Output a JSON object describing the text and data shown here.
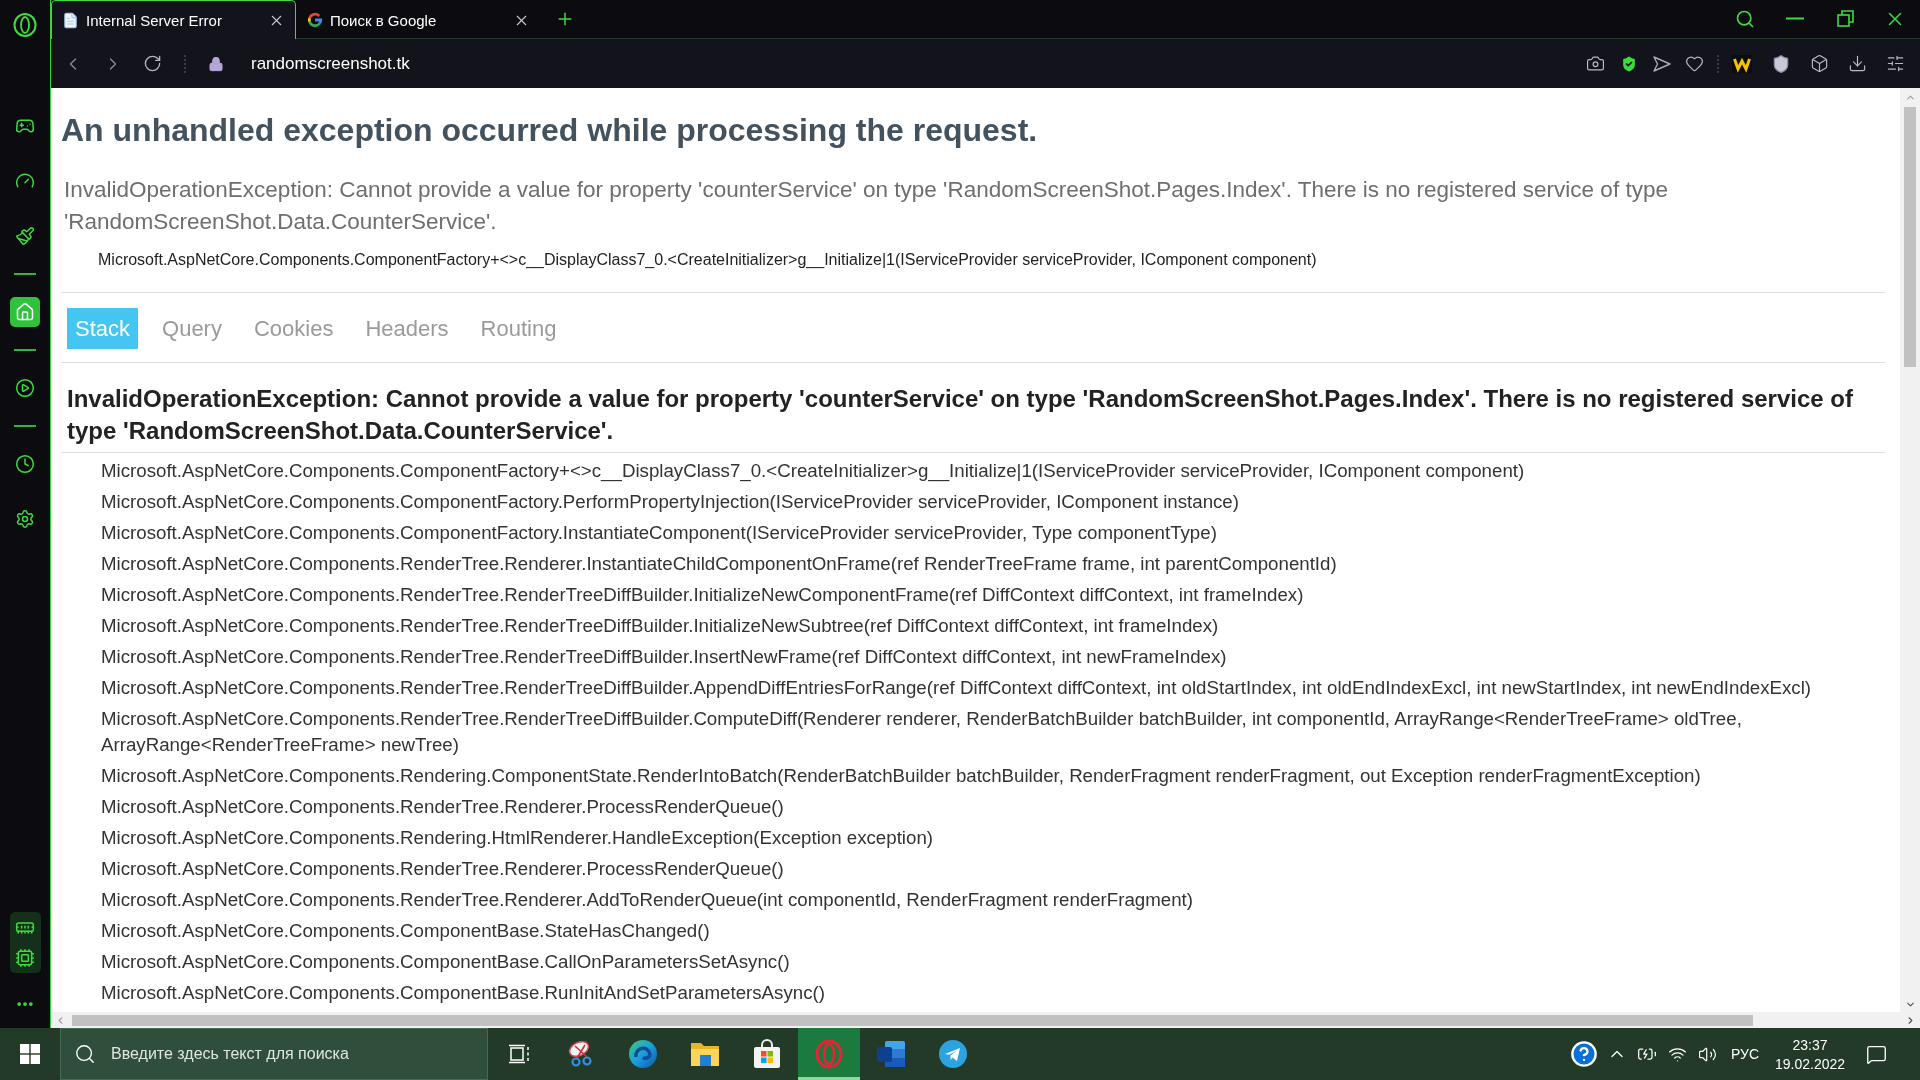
{
  "browser": {
    "tabs": [
      {
        "title": "Internal Server Error",
        "selected": true
      },
      {
        "title": "Поиск в Google",
        "selected": false
      }
    ],
    "address": "randomscreenshot.tk"
  },
  "sidebar": {
    "items": [
      {
        "kind": "button",
        "selected": false
      },
      {
        "kind": "button",
        "selected": false
      },
      {
        "kind": "button",
        "selected": false
      },
      {
        "kind": "divider"
      },
      {
        "kind": "button",
        "selected": true
      },
      {
        "kind": "divider"
      },
      {
        "kind": "button",
        "selected": false
      },
      {
        "kind": "divider"
      },
      {
        "kind": "button",
        "selected": false
      },
      {
        "kind": "button",
        "selected": false
      }
    ]
  },
  "page": {
    "title": "An unhandled exception occurred while processing the request.",
    "message": "InvalidOperationException: Cannot provide a value for property 'counterService' on type 'RandomScreenShot.Pages.Index'. There is no registered service of type 'RandomScreenShot.Data.CounterService'.",
    "location": "Microsoft.AspNetCore.Components.ComponentFactory+<>c__DisplayClass7_0.<CreateInitializer>g__Initialize|1(IServiceProvider serviceProvider, IComponent component)",
    "tabs": [
      {
        "label": "Stack",
        "selected": true
      },
      {
        "label": "Query",
        "selected": false
      },
      {
        "label": "Cookies",
        "selected": false
      },
      {
        "label": "Headers",
        "selected": false
      },
      {
        "label": "Routing",
        "selected": false
      }
    ],
    "exception": {
      "message": "InvalidOperationException: Cannot provide a value for property 'counterService' on type 'RandomScreenShot.Pages.Index'. There is no registered service of type 'RandomScreenShot.Data.CounterService'.",
      "frames": [
        "Microsoft.AspNetCore.Components.ComponentFactory+<>c__DisplayClass7_0.<CreateInitializer>g__Initialize|1(IServiceProvider serviceProvider, IComponent component)",
        "Microsoft.AspNetCore.Components.ComponentFactory.PerformPropertyInjection(IServiceProvider serviceProvider, IComponent instance)",
        "Microsoft.AspNetCore.Components.ComponentFactory.InstantiateComponent(IServiceProvider serviceProvider, Type componentType)",
        "Microsoft.AspNetCore.Components.RenderTree.Renderer.InstantiateChildComponentOnFrame(ref RenderTreeFrame frame, int parentComponentId)",
        "Microsoft.AspNetCore.Components.RenderTree.RenderTreeDiffBuilder.InitializeNewComponentFrame(ref DiffContext diffContext, int frameIndex)",
        "Microsoft.AspNetCore.Components.RenderTree.RenderTreeDiffBuilder.InitializeNewSubtree(ref DiffContext diffContext, int frameIndex)",
        "Microsoft.AspNetCore.Components.RenderTree.RenderTreeDiffBuilder.InsertNewFrame(ref DiffContext diffContext, int newFrameIndex)",
        "Microsoft.AspNetCore.Components.RenderTree.RenderTreeDiffBuilder.AppendDiffEntriesForRange(ref DiffContext diffContext, int oldStartIndex, int oldEndIndexExcl, int newStartIndex, int newEndIndexExcl)",
        "Microsoft.AspNetCore.Components.RenderTree.RenderTreeDiffBuilder.ComputeDiff(Renderer renderer, RenderBatchBuilder batchBuilder, int componentId, ArrayRange<RenderTreeFrame> oldTree, ArrayRange<RenderTreeFrame> newTree)",
        "Microsoft.AspNetCore.Components.Rendering.ComponentState.RenderIntoBatch(RenderBatchBuilder batchBuilder, RenderFragment renderFragment, out Exception renderFragmentException)",
        "Microsoft.AspNetCore.Components.RenderTree.Renderer.ProcessRenderQueue()",
        "Microsoft.AspNetCore.Components.Rendering.HtmlRenderer.HandleException(Exception exception)",
        "Microsoft.AspNetCore.Components.RenderTree.Renderer.ProcessRenderQueue()",
        "Microsoft.AspNetCore.Components.RenderTree.Renderer.AddToRenderQueue(int componentId, RenderFragment renderFragment)",
        "Microsoft.AspNetCore.Components.ComponentBase.StateHasChanged()",
        "Microsoft.AspNetCore.Components.ComponentBase.CallOnParametersSetAsync()",
        "Microsoft.AspNetCore.Components.ComponentBase.RunInitAndSetParametersAsync()"
      ]
    }
  },
  "taskbar": {
    "search": {
      "placeholder": "Введите здесь текст для поиска"
    },
    "apps": [
      {
        "selected": false
      },
      {
        "selected": false
      },
      {
        "selected": false
      },
      {
        "selected": false
      },
      {
        "selected": true
      },
      {
        "selected": false
      },
      {
        "selected": false
      }
    ],
    "language": "РУС",
    "time": "23:37",
    "date": "19.02.2022"
  }
}
